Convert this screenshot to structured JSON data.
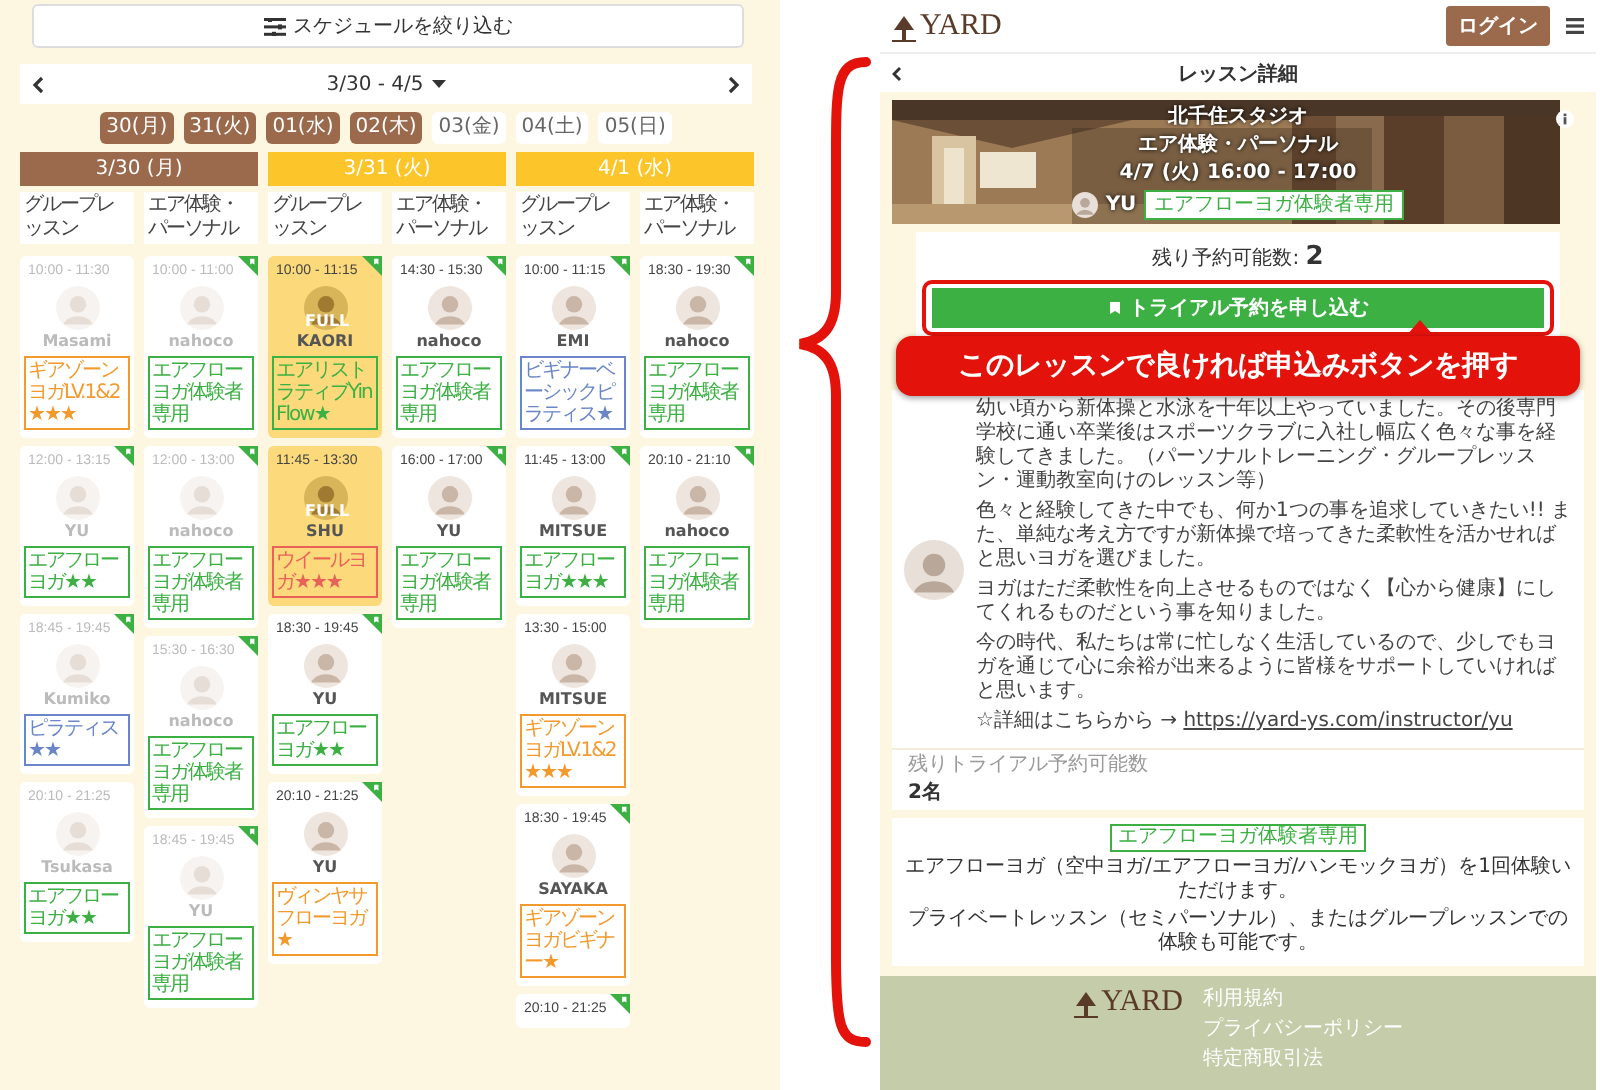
{
  "filter_button": {
    "label": "スケジュールを絞り込む"
  },
  "date_nav": {
    "range": "3/30 - 4/5"
  },
  "date_chips": [
    {
      "label": "30(月)",
      "selected": true
    },
    {
      "label": "31(火)",
      "selected": true
    },
    {
      "label": "01(水)",
      "selected": true
    },
    {
      "label": "02(木)",
      "selected": true
    },
    {
      "label": "03(金)",
      "selected": false
    },
    {
      "label": "04(土)",
      "selected": false
    },
    {
      "label": "05(日)",
      "selected": false
    }
  ],
  "days": [
    {
      "label": "3/30 (月)",
      "past": true,
      "columns": [
        {
          "category": "グループレッスン",
          "lessons": [
            {
              "time": "10:00 - 11:30",
              "instructor": "Masami",
              "tag": "ギアゾーンヨガLV.1&2★★★",
              "color": "#f39a2e",
              "past": true,
              "full": false,
              "trial": false
            },
            {
              "time": "12:00 - 13:15",
              "instructor": "YU",
              "tag": "エアフローヨガ★★",
              "color": "#3cb043",
              "past": true,
              "full": false,
              "trial": true
            },
            {
              "time": "18:45 - 19:45",
              "instructor": "Kumiko",
              "tag": "ピラティス★★",
              "color": "#6a86c8",
              "past": true,
              "full": false,
              "trial": true
            },
            {
              "time": "20:10 - 21:25",
              "instructor": "Tsukasa",
              "tag": "エアフローヨガ★★",
              "color": "#3cb043",
              "past": true,
              "full": false,
              "trial": false
            }
          ]
        },
        {
          "category": "エア体験・パーソナル",
          "lessons": [
            {
              "time": "10:00 - 11:00",
              "instructor": "nahoco",
              "tag": "エアフローヨガ体験者専用",
              "color": "#3cb043",
              "past": true,
              "full": false,
              "trial": true
            },
            {
              "time": "12:00 - 13:00",
              "instructor": "nahoco",
              "tag": "エアフローヨガ体験者専用",
              "color": "#3cb043",
              "past": true,
              "full": false,
              "trial": true
            },
            {
              "time": "15:30 - 16:30",
              "instructor": "nahoco",
              "tag": "エアフローヨガ体験者専用",
              "color": "#3cb043",
              "past": true,
              "full": false,
              "trial": true
            },
            {
              "time": "18:45 - 19:45",
              "instructor": "YU",
              "tag": "エアフローヨガ体験者専用",
              "color": "#3cb043",
              "past": true,
              "full": false,
              "trial": true
            }
          ]
        }
      ]
    },
    {
      "label": "3/31 (火)",
      "past": false,
      "columns": [
        {
          "category": "グループレッスン",
          "lessons": [
            {
              "time": "10:00 - 11:15",
              "instructor": "KAORI",
              "tag": "エアリストラティブYin Flow★",
              "color": "#3cb043",
              "past": false,
              "full": true,
              "full_label": "FULL",
              "trial": true
            },
            {
              "time": "11:45 - 13:30",
              "instructor": "SHU",
              "tag": "ウイールヨガ★★★",
              "color": "#e8625a",
              "past": false,
              "full": true,
              "full_label": "FULL",
              "trial": false
            },
            {
              "time": "18:30 - 19:45",
              "instructor": "YU",
              "tag": "エアフローヨガ★★",
              "color": "#3cb043",
              "past": false,
              "full": false,
              "trial": true
            },
            {
              "time": "20:10 - 21:25",
              "instructor": "YU",
              "tag": "ヴィンヤサフローヨガ★",
              "color": "#f39a2e",
              "past": false,
              "full": false,
              "trial": true
            }
          ]
        },
        {
          "category": "エア体験・パーソナル",
          "lessons": [
            {
              "time": "14:30 - 15:30",
              "instructor": "nahoco",
              "tag": "エアフローヨガ体験者専用",
              "color": "#3cb043",
              "past": false,
              "full": false,
              "trial": true
            },
            {
              "time": "16:00 - 17:00",
              "instructor": "YU",
              "tag": "エアフローヨガ体験者専用",
              "color": "#3cb043",
              "past": false,
              "full": false,
              "trial": true
            }
          ]
        }
      ]
    },
    {
      "label": "4/1 (水)",
      "past": false,
      "columns": [
        {
          "category": "グループレッスン",
          "lessons": [
            {
              "time": "10:00 - 11:15",
              "instructor": "EMI",
              "tag": "ビギナーベーシックピラティス★",
              "color": "#6a86c8",
              "past": false,
              "full": false,
              "trial": true
            },
            {
              "time": "11:45 - 13:00",
              "instructor": "MITSUE",
              "tag": "エアフローヨガ★★★",
              "color": "#3cb043",
              "past": false,
              "full": false,
              "trial": true
            },
            {
              "time": "13:30 - 15:00",
              "instructor": "MITSUE",
              "tag": "ギアゾーンヨガLV.1&2★★★",
              "color": "#f39a2e",
              "past": false,
              "full": false,
              "trial": false
            },
            {
              "time": "18:30 - 19:45",
              "instructor": "SAYAKA",
              "tag": "ギアゾーンヨガビギナー★",
              "color": "#f39a2e",
              "past": false,
              "full": false,
              "trial": true
            },
            {
              "time": "20:10 - 21:25",
              "past": false,
              "full": false,
              "trial": true
            }
          ]
        },
        {
          "category": "エア体験・パーソナル",
          "lessons": [
            {
              "time": "18:30 - 19:30",
              "instructor": "nahoco",
              "tag": "エアフローヨガ体験者専用",
              "color": "#3cb043",
              "past": false,
              "full": false,
              "trial": true
            },
            {
              "time": "20:10 - 21:10",
              "instructor": "nahoco",
              "tag": "エアフローヨガ体験者専用",
              "color": "#3cb043",
              "past": false,
              "full": false,
              "trial": true
            }
          ]
        }
      ]
    }
  ],
  "header": {
    "logo": "YARD",
    "login_button": "ログイン"
  },
  "detail": {
    "title": "レッスン詳細",
    "studio": "北千住スタジオ",
    "lesson": "エア体験・パーソナル",
    "datetime": "4/7 (火) 16:00 - 17:00",
    "instructor": "YU",
    "tag": "エアフローヨガ体験者専用",
    "remaining": "残り予約可能数: **2**",
    "apply_button": "トライアル予約を申し込む",
    "bio": [
      "幼い頃から新体操と水泳を十年以上やっていました。その後専門学校に通い卒業後はスポーツクラブに入社し幅広く色々な事を経験してきました。（パーソナルトレーニング・グループレッスン・運動教室向けのレッスン等）",
      "色々と経験してきた中でも、何か1つの事を追求していきたい!! また、単純な考え方ですが新体操で培ってきた柔軟性を活かせればと思いヨガを選びました。",
      "ヨガはただ柔軟性を向上させるものではなく【心から健康】にしてくれるものだという事を知りました。",
      "今の時代、私たちは常に忙しなく生活しているので、少しでもヨガを通じて心に余裕が出来るように皆様をサポートしていければと思います。"
    ],
    "link_prefix": "☆詳細はこちらから → ",
    "link": "https://yard-ys.com/instructor/yu",
    "trial_label": "残りトライアル予約可能数",
    "trial_count": "2名",
    "info_tag": "エアフローヨガ体験者専用",
    "info": [
      "エアフローヨガ（空中ヨガ/エアフローヨガ/ハンモックヨガ）を1回体験いただけます。",
      "プライベートレッスン（セミパーソナル）、またはグループレッスンでの体験も可能です。"
    ]
  },
  "callout": "このレッスンで良ければ申込みボタンを押す",
  "footer": {
    "logo": "YARD",
    "links": [
      "利用規約",
      "プライバシーポリシー",
      "特定商取引法"
    ]
  }
}
